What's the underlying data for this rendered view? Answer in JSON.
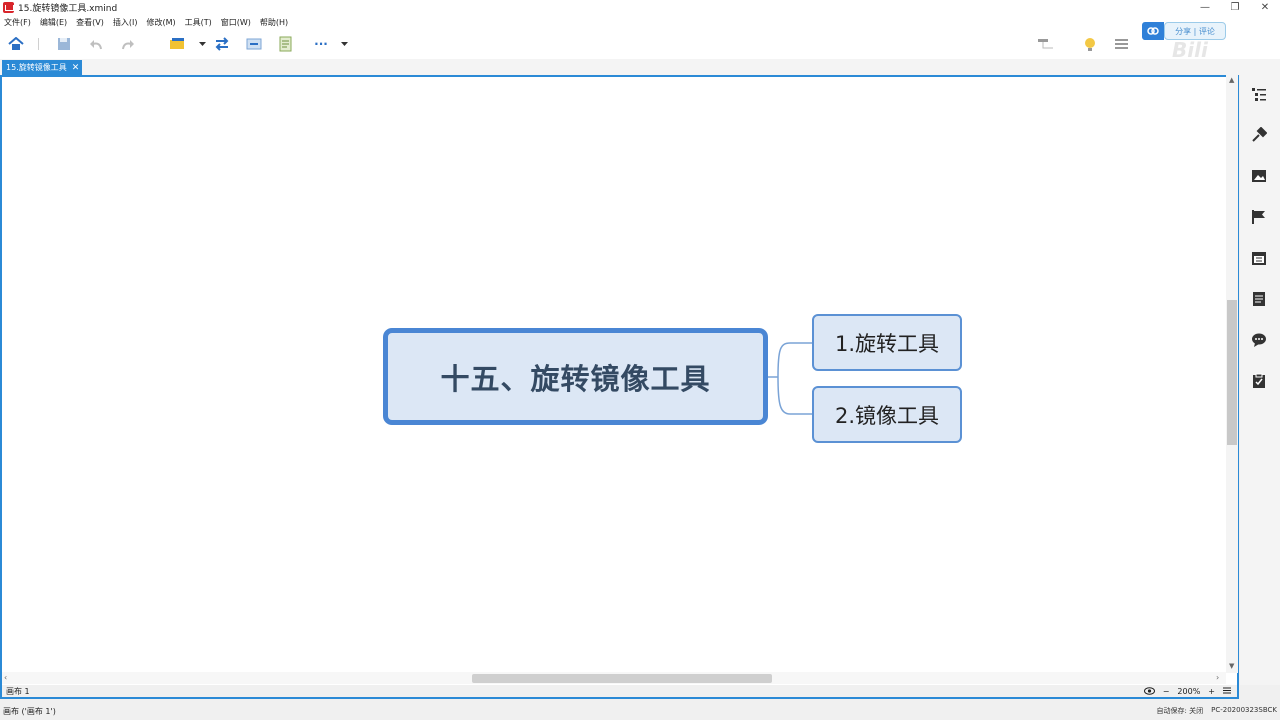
{
  "window": {
    "title": "15.旋转镜像工具.xmind",
    "minimize": "—",
    "restore": "❐",
    "close": "✕"
  },
  "menu": {
    "items": [
      "文件(F)",
      "编辑(E)",
      "查看(V)",
      "插入(I)",
      "修改(M)",
      "工具(T)",
      "窗口(W)",
      "帮助(H)"
    ]
  },
  "toolbar": {
    "share_label": "分享 | 评论",
    "more_label": "···"
  },
  "tabs": {
    "document": "15.旋转镜像工具",
    "close": "✕"
  },
  "mindmap": {
    "central_topic": "十五、旋转镜像工具",
    "branches": [
      {
        "label": "1.旋转工具"
      },
      {
        "label": "2.镜像工具"
      }
    ],
    "colors": {
      "topic_fill": "#dce7f5",
      "central_border": "#4a86d4",
      "branch_border": "#5b91d4",
      "connector": "#7aa3d6"
    }
  },
  "canvas_status": {
    "sheet_tab": "画布 1",
    "zoom": "200%",
    "zoom_out": "−",
    "zoom_in": "+"
  },
  "status": {
    "left": "画布 ('画布 1')",
    "autosave": "自动保存: 关闭",
    "device": "PC-20200323SBCK"
  },
  "icons": {
    "toolbar": [
      "home-icon",
      "save-icon",
      "undo-icon",
      "redo-icon",
      "topic-style-icon",
      "relationship-icon",
      "summary-icon",
      "notes-icon",
      "more-icon"
    ],
    "right_panel": [
      "outline-icon",
      "format-icon",
      "image-icon",
      "marker-icon",
      "calendar-icon",
      "notes-icon",
      "comment-icon",
      "task-icon"
    ]
  }
}
